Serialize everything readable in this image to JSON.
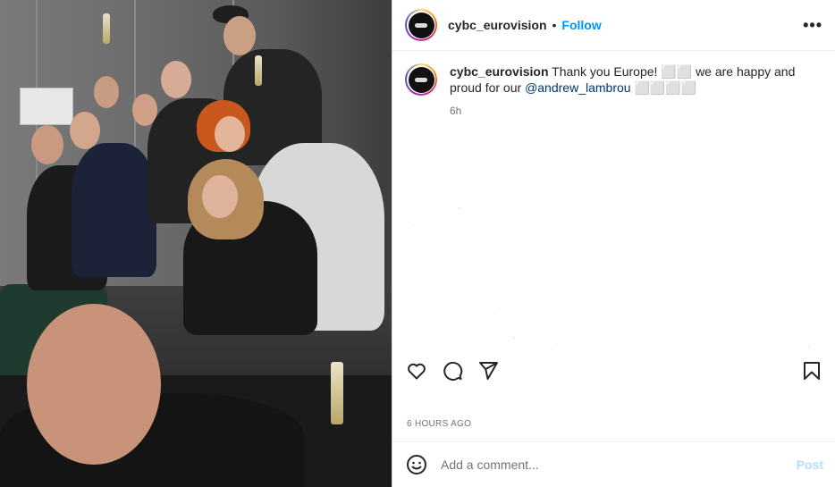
{
  "post": {
    "username": "cybc_eurovision",
    "follow_label": "Follow",
    "separator": "•",
    "more_label": "•••",
    "caption_user": "cybc_eurovision",
    "caption_text": " Thank you Europe! ⬜⬜ we are happy and proud for our ",
    "caption_mention": "@andrew_lambrou",
    "caption_suffix": " ⬜⬜⬜⬜",
    "caption_time": "6h",
    "timestamp": "6 HOURS AGO"
  },
  "comment": {
    "placeholder": "Add a comment...",
    "post_label": "Post"
  },
  "icons": {
    "like": "heart-icon",
    "comment": "comment-icon",
    "share": "paper-plane-icon",
    "save": "bookmark-icon",
    "emoji": "smiley-icon",
    "more": "more-dots-icon"
  },
  "colors": {
    "link": "#0095f6",
    "mention": "#00376b",
    "post_disabled": "#b2dffc",
    "muted": "#737373"
  }
}
